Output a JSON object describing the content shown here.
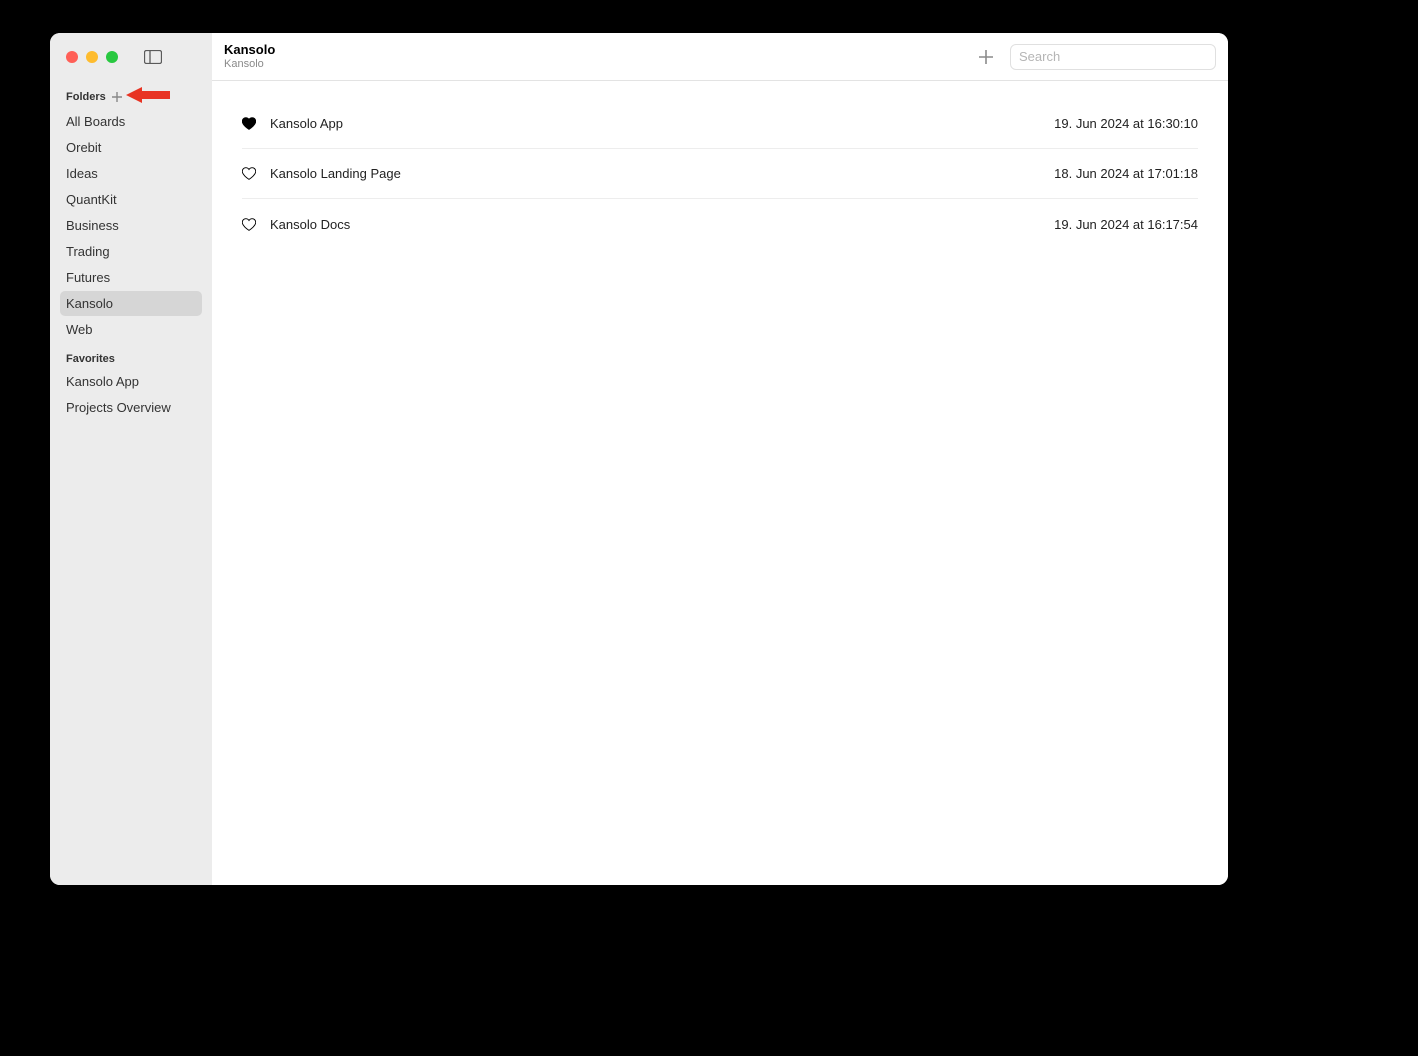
{
  "titlebar": {
    "title": "Kansolo",
    "subtitle": "Kansolo"
  },
  "search": {
    "placeholder": "Search"
  },
  "sidebar": {
    "folders_label": "Folders",
    "items": [
      {
        "label": "All Boards",
        "selected": false
      },
      {
        "label": "Orebit",
        "selected": false
      },
      {
        "label": "Ideas",
        "selected": false
      },
      {
        "label": "QuantKit",
        "selected": false
      },
      {
        "label": "Business",
        "selected": false
      },
      {
        "label": "Trading",
        "selected": false
      },
      {
        "label": "Futures",
        "selected": false
      },
      {
        "label": "Kansolo",
        "selected": true
      },
      {
        "label": "Web",
        "selected": false
      }
    ],
    "favorites_label": "Favorites",
    "favorites": [
      {
        "label": "Kansolo App"
      },
      {
        "label": "Projects Overview"
      }
    ]
  },
  "boards": [
    {
      "title": "Kansolo App",
      "date": "19. Jun 2024 at 16:30:10",
      "favorited": true
    },
    {
      "title": "Kansolo Landing Page",
      "date": "18. Jun 2024 at 17:01:18",
      "favorited": false
    },
    {
      "title": "Kansolo Docs",
      "date": "19. Jun 2024 at 16:17:54",
      "favorited": false
    }
  ]
}
